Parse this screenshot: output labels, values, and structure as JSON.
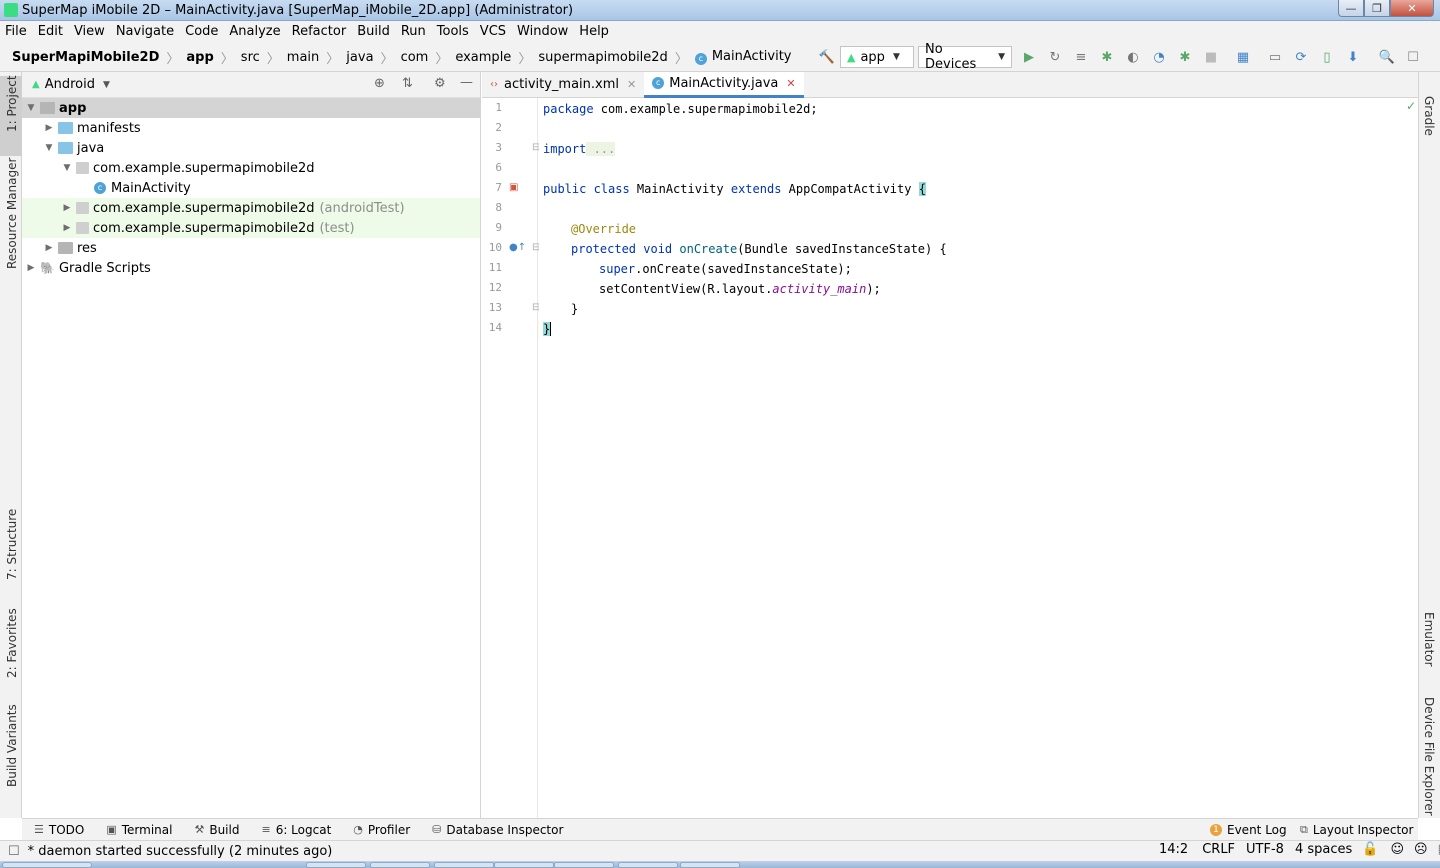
{
  "window": {
    "title": "SuperMap iMobile 2D – MainActivity.java [SuperMap_iMobile_2D.app] (Administrator)",
    "buttons": [
      "minimize",
      "maximize",
      "close"
    ]
  },
  "menu": [
    "File",
    "Edit",
    "View",
    "Navigate",
    "Code",
    "Analyze",
    "Refactor",
    "Build",
    "Run",
    "Tools",
    "VCS",
    "Window",
    "Help"
  ],
  "breadcrumb": [
    "SuperMapiMobile2D",
    "app",
    "src",
    "main",
    "java",
    "com",
    "example",
    "supermapimobile2d",
    "MainActivity"
  ],
  "toolbar": {
    "config": "app",
    "device": "No Devices"
  },
  "project": {
    "view": "Android",
    "tree": {
      "app": "app",
      "manifests": "manifests",
      "java": "java",
      "pkg_main": "com.example.supermapimobile2d",
      "main_activity": "MainActivity",
      "pkg_android_test": "com.example.supermapimobile2d",
      "android_test_tag": "(androidTest)",
      "pkg_test": "com.example.supermapimobile2d",
      "test_tag": "(test)",
      "res": "res",
      "gradle": "Gradle Scripts"
    }
  },
  "editor": {
    "tabs": [
      "activity_main.xml",
      "MainActivity.java"
    ],
    "active_tab": "MainActivity.java",
    "line_numbers": [
      "1",
      "2",
      "3",
      "6",
      "7",
      "8",
      "9",
      "10",
      "11",
      "12",
      "13",
      "14"
    ],
    "code": {
      "l1_kw": "package",
      "l1_rest": " com.example.supermapimobile2d;",
      "l3_kw": "import",
      "l3_rest": " ...",
      "l7_kw": "public class",
      "l7_name": " MainActivity ",
      "l7_kw2": "extends",
      "l7_rest": " AppCompatActivity ",
      "l7_brace": "{",
      "l9": "@Override",
      "l10_kw": "protected void",
      "l10_fn": " onCreate",
      "l10_rest": "(Bundle savedInstanceState) {",
      "l11_kw": "super",
      "l11_rest": ".onCreate(savedInstanceState);",
      "l12_a": "setContentView(R.layout.",
      "l12_it": "activity_main",
      "l12_b": ");",
      "l13": "}",
      "l14": "}"
    }
  },
  "left_tools": [
    "1: Project",
    "Resource Manager",
    "7: Structure",
    "2: Favorites",
    "Build Variants"
  ],
  "right_tools": [
    "Gradle",
    "Emulator",
    "Device File Explorer"
  ],
  "bottom_tools": {
    "todo": "TODO",
    "terminal": "Terminal",
    "build": "Build",
    "logcat": "6: Logcat",
    "profiler": "Profiler",
    "db": "Database Inspector",
    "event_log": "Event Log",
    "event_count": "1",
    "layout_inspector": "Layout Inspector"
  },
  "status": {
    "message": "* daemon started successfully (2 minutes ago)",
    "position": "14:2",
    "line_sep": "CRLF",
    "encoding": "UTF-8",
    "indent": "4 spaces"
  },
  "colors": {
    "accent": "#4083c9",
    "android_green": "#3ddc84",
    "run_green": "#59a869",
    "keyword": "#0033b3",
    "annotation": "#9e880d",
    "italic_field": "#871094"
  }
}
